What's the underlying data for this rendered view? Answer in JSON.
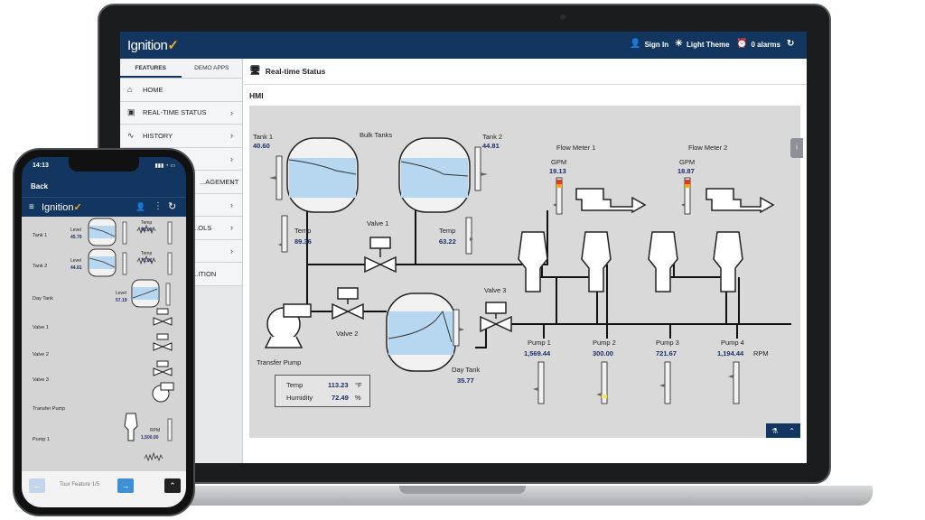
{
  "laptop": {
    "header": {
      "logo": "Ignition",
      "sign_in": "Sign In",
      "theme": "Light Theme",
      "alarms": "0 alarms"
    },
    "sidebar": {
      "tabs": [
        "FEATURES",
        "DEMO APPS"
      ],
      "items": [
        {
          "label": "HOME",
          "icon": "home-icon"
        },
        {
          "label": "REAL-TIME STATUS",
          "icon": "status-icon"
        },
        {
          "label": "HISTORY",
          "icon": "trend-icon"
        },
        {
          "label": "",
          "icon": ""
        },
        {
          "label": "...AGEMENT",
          "icon": ""
        },
        {
          "label": "",
          "icon": ""
        },
        {
          "label": "...OLS",
          "icon": ""
        },
        {
          "label": "",
          "icon": ""
        },
        {
          "label": "...ITION",
          "icon": ""
        }
      ]
    },
    "content": {
      "title": "Real-time Status",
      "section": "HMI"
    },
    "hmi": {
      "bulk_tanks": "Bulk Tanks",
      "tank1": {
        "label": "Tank 1",
        "value": "40.60"
      },
      "tank2": {
        "label": "Tank 2",
        "value": "44.81"
      },
      "temp_left": {
        "label": "Temp",
        "value": "89.36"
      },
      "temp_right": {
        "label": "Temp",
        "value": "63.22"
      },
      "valve1": "Valve 1",
      "valve2": "Valve 2",
      "valve3": "Valve 3",
      "transfer_pump": "Transfer Pump",
      "day_tank": {
        "label": "Day Tank",
        "value": "35.77"
      },
      "flow_meter_1": {
        "label": "Flow Meter 1",
        "unit": "GPM",
        "value": "19.13"
      },
      "flow_meter_2": {
        "label": "Flow Meter 2",
        "unit": "GPM",
        "value": "18.87"
      },
      "pumps": [
        {
          "label": "Pump 1",
          "value": "1,569.44"
        },
        {
          "label": "Pump 2",
          "value": "300.00"
        },
        {
          "label": "Pump 3",
          "value": "721.67"
        },
        {
          "label": "Pump 4",
          "value": "1,194.44"
        }
      ],
      "rpm_unit": "RPM",
      "readout": {
        "temp_label": "Temp",
        "temp_value": "113.23",
        "temp_unit": "°F",
        "humidity_label": "Humidity",
        "humidity_value": "72.49",
        "humidity_unit": "%"
      }
    }
  },
  "phone": {
    "time": "14:13",
    "back": "Back",
    "logo": "Ignition",
    "rows": {
      "tank1": {
        "label": "Tank 1",
        "level_label": "Level",
        "level_value": "45.70",
        "temp_label": "Temp",
        "temp_value": "96.09"
      },
      "tank2": {
        "label": "Tank 2",
        "level_label": "Level",
        "level_value": "44.81",
        "temp_label": "Temp",
        "temp_value": "70.31"
      },
      "day_tank": {
        "label": "Day Tank",
        "level_label": "Level",
        "level_value": "57.19"
      },
      "valve1": "Valve 1",
      "valve2": "Valve 2",
      "valve3": "Valve 3",
      "transfer_pump": "Transfer Pump",
      "pump1": {
        "label": "Pump 1",
        "rpm_label": "RPM",
        "rpm_value": "1,500.00"
      }
    },
    "footer": {
      "tour": "Tour Feature 1/5"
    }
  },
  "colors": {
    "header_blue": "#12365f",
    "accent_orange": "#f7a823",
    "value_blue": "#1c2f6b",
    "tank_fill": "#b7d6ef",
    "hmi_background": "#d9d9d9"
  }
}
